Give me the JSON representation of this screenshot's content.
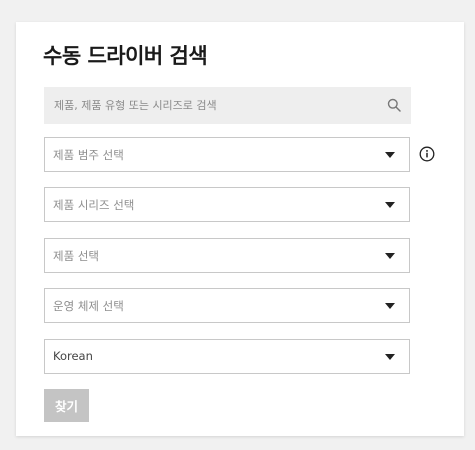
{
  "page": {
    "title": "수동 드라이버 검색"
  },
  "search": {
    "placeholder": "제품, 제품 유형 또는 시리즈로 검색",
    "value": "",
    "icon": "search-icon"
  },
  "selects": {
    "category": {
      "label": "제품 범주 선택",
      "icon": "chevron-down-icon"
    },
    "series": {
      "label": "제품 시리즈 선택",
      "icon": "chevron-down-icon"
    },
    "product": {
      "label": "제품 선택",
      "icon": "chevron-down-icon"
    },
    "os": {
      "label": "운영 체제 선택",
      "icon": "chevron-down-icon"
    },
    "language": {
      "label": "Korean",
      "icon": "chevron-down-icon"
    }
  },
  "info": {
    "icon": "info-icon"
  },
  "actions": {
    "find_label": "찾기"
  },
  "colors": {
    "page_background": "#f1f1f1",
    "card_background": "#ffffff",
    "search_background": "#eeeeee",
    "select_border": "#c8c8c8",
    "button_disabled": "#c4c4c4",
    "title_text": "#1a1a1a",
    "placeholder_text": "#8e8e8e"
  }
}
